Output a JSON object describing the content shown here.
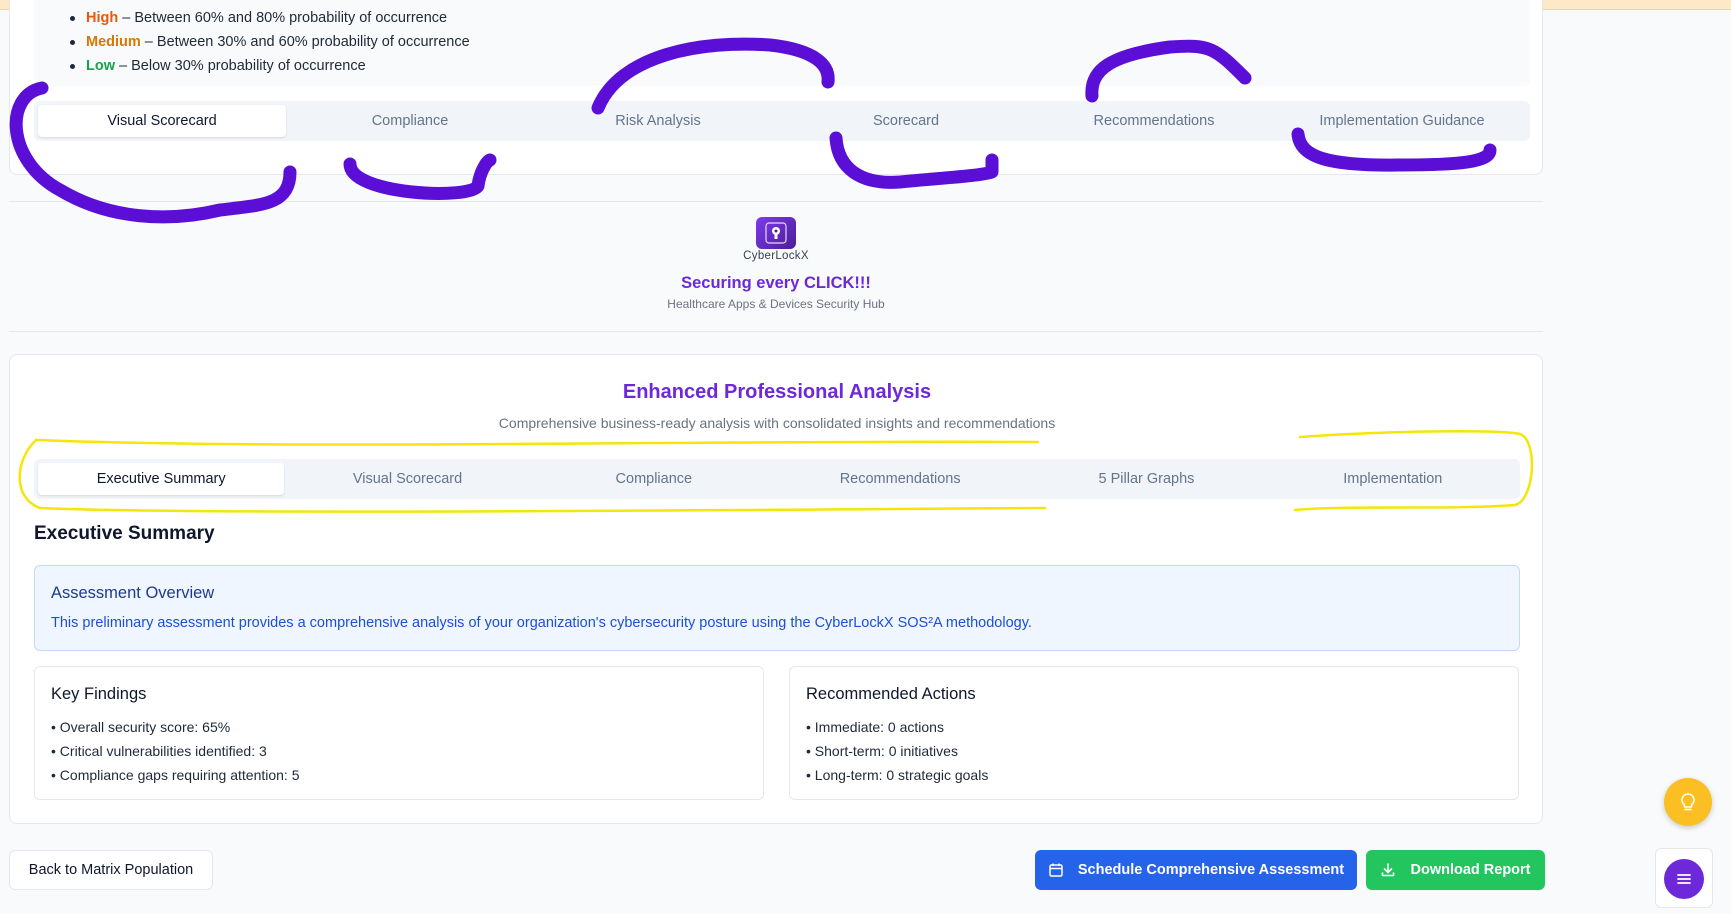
{
  "risk_legend": [
    {
      "level": "High",
      "text": " – Between 60% and 80% probability of occurrence",
      "color": "#ea580c"
    },
    {
      "level": "Medium",
      "text": " – Between 30% and 60% probability of occurrence",
      "color": "#d97706"
    },
    {
      "level": "Low",
      "text": " – Below 30% probability of occurrence",
      "color": "#16a34a"
    }
  ],
  "top_tabs": [
    "Visual Scorecard",
    "Compliance",
    "Risk Analysis",
    "Scorecard",
    "Recommendations",
    "Implementation Guidance"
  ],
  "top_tabs_active": "Visual Scorecard",
  "brand": {
    "name": "CyberLockX",
    "tagline": "Securing every CLICK!!!",
    "subtitle": "Healthcare Apps & Devices Security Hub"
  },
  "analysis": {
    "title": "Enhanced Professional Analysis",
    "subtitle": "Comprehensive business-ready analysis with consolidated insights and recommendations",
    "tabs": [
      "Executive Summary",
      "Visual Scorecard",
      "Compliance",
      "Recommendations",
      "5 Pillar Graphs",
      "Implementation"
    ],
    "active_tab": "Executive Summary",
    "section_title": "Executive Summary",
    "overview": {
      "title": "Assessment Overview",
      "text": "This preliminary assessment provides a comprehensive analysis of your organization's cybersecurity posture using the CyberLockX SOS²A methodology."
    },
    "key_findings": {
      "title": "Key Findings",
      "items": [
        "Overall security score: 65%",
        "Critical vulnerabilities identified: 3",
        "Compliance gaps requiring attention: 5"
      ]
    },
    "recommended_actions": {
      "title": "Recommended Actions",
      "items": [
        "Immediate: 0 actions",
        "Short-term: 0 initiatives",
        "Long-term: 0 strategic goals"
      ]
    }
  },
  "buttons": {
    "back": "Back to Matrix Population",
    "schedule": "Schedule Comprehensive Assessment",
    "download": "Download Report"
  },
  "icons": {
    "schedule": "calendar-icon",
    "download": "download-icon",
    "fab_bulb": "lightbulb-icon",
    "fab_menu": "menu-icon"
  },
  "colors": {
    "brand_purple": "#6d28d9",
    "primary_blue": "#2563eb",
    "success_green": "#22c55e",
    "bulb_yellow": "#fbbf24",
    "annotation_purple": "#5b21d6",
    "annotation_yellow": "#f5e60a"
  }
}
